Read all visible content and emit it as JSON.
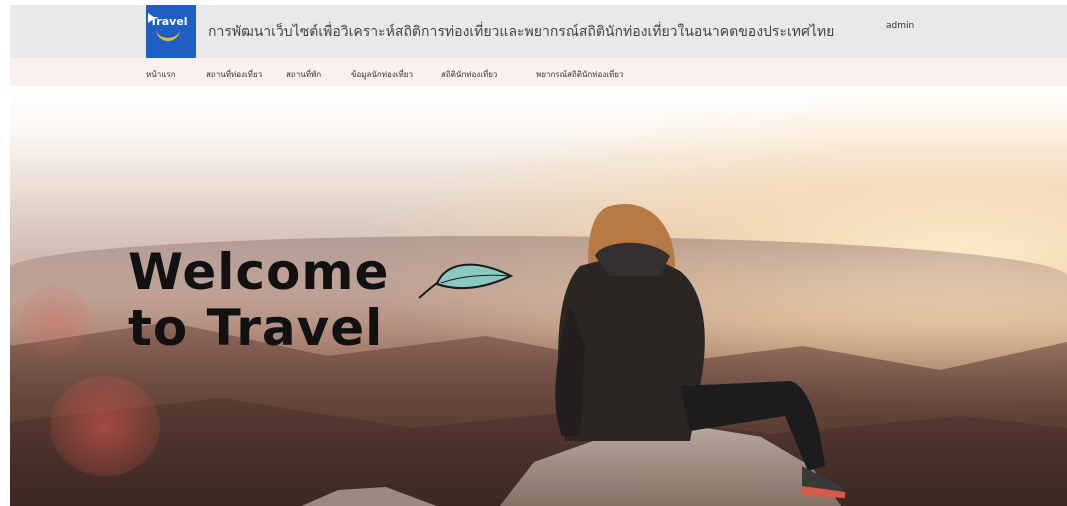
{
  "header": {
    "logo_text": "Travel",
    "title": "การพัฒนาเว็บไซต์เพื่อวิเคราะห์สถิติการท่องเที่ยวและพยากรณ์สถิตินักท่องเที่ยวในอนาคตของประเทศไทย",
    "user": "admin"
  },
  "nav": {
    "items": [
      {
        "label": "หน้าแรก"
      },
      {
        "label": "สถานที่ท่องเที่ยว"
      },
      {
        "label": "สถานที่พัก"
      },
      {
        "label": "ข้อมูลนักท่องเที่ยว"
      },
      {
        "label": "สถิตินักท่องเที่ยว"
      },
      {
        "label": "พยากรณ์สถิตินักท่องเที่ยว"
      }
    ]
  },
  "hero": {
    "line1": "Welcome",
    "line2": "to Travel",
    "leaf_icon": "leaf-icon"
  },
  "colors": {
    "logo_bg": "#1f5fc4",
    "topbar_bg": "#e9e9e9",
    "navbar_bg": "#fbf0ee"
  }
}
